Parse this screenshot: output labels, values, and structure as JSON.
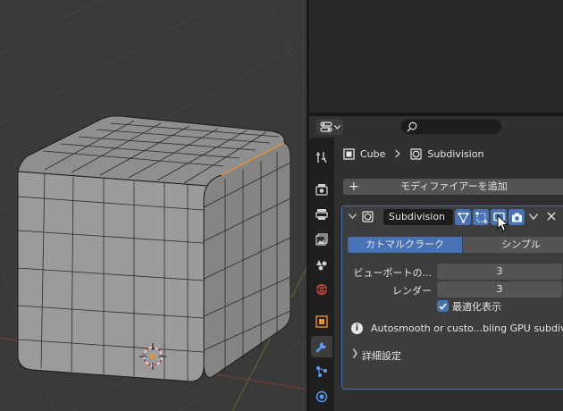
{
  "breadcrumb": {
    "object": "Cube",
    "modifier": "Subdivision"
  },
  "add_modifier_label": "モディファイアーを追加",
  "modifier_panel": {
    "name": "Subdivision",
    "mode_catmull": "カトマルクラーク",
    "mode_simple": "シンプル",
    "viewport_levels_label": "ビューポートの...",
    "viewport_levels_value": "3",
    "render_label": "レンダー",
    "render_value": "3",
    "optimal_display_label": "最適化表示",
    "optimal_display_checked": true,
    "info_text": "Autosmooth or custo...bling GPU subdivisi",
    "advanced_label": "詳細設定"
  },
  "tabs": [
    {
      "icon": "tool-icon",
      "active": false
    },
    {
      "icon": "render-icon",
      "active": false
    },
    {
      "icon": "output-icon",
      "active": false
    },
    {
      "icon": "view-layer-icon",
      "active": false
    },
    {
      "icon": "scene-icon",
      "active": false
    },
    {
      "icon": "world-icon",
      "active": false
    },
    {
      "icon": "object-icon",
      "active": false
    },
    {
      "icon": "modifier-wrench-icon",
      "active": true
    },
    {
      "icon": "particles-icon",
      "active": false
    },
    {
      "icon": "physics-icon",
      "active": false
    }
  ],
  "colors": {
    "accent_blue": "#4772b3",
    "panel_bg": "#3d3d3d",
    "editor_bg": "#303030",
    "tab_bg": "#1f1f1f",
    "selection_orange": "#e8912e"
  }
}
